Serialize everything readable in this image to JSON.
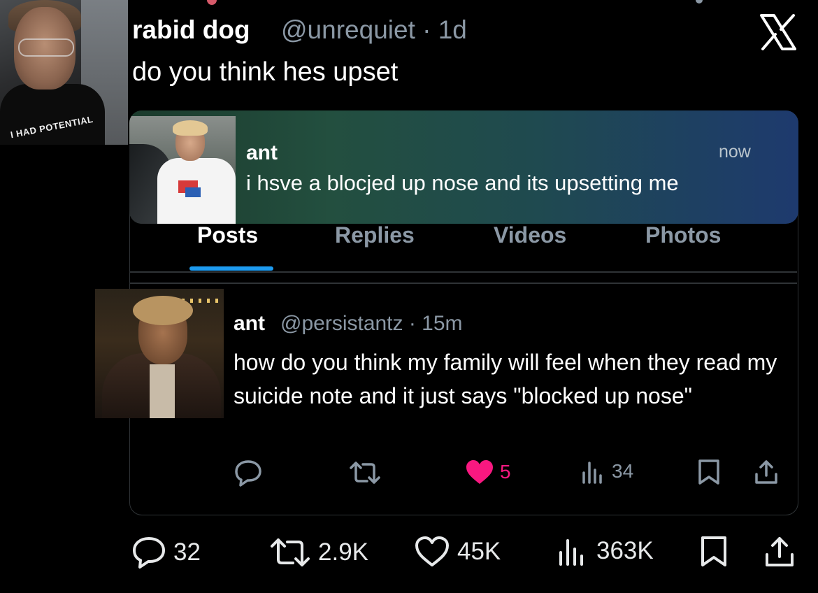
{
  "header": {
    "name": "rabid dog",
    "handle_time": "@unrequiet · 1d",
    "text": "do you think hes upset",
    "avatar_shirt_text": "I HAD POTENTIAL"
  },
  "notification": {
    "name": "ant",
    "time": "now",
    "text": "i hsve a blocjed up nose and its upsetting me"
  },
  "tabs": [
    "Posts",
    "Replies",
    "Videos",
    "Photos"
  ],
  "tweet": {
    "name": "ant",
    "handle_time": "@persistantz · 15m",
    "text": "how do you think my family will feel when they read my suicide note and it just says \"blocked up nose\"",
    "actions": {
      "likes": "5",
      "views": "34"
    }
  },
  "stats": {
    "replies": "32",
    "reposts": "2.9K",
    "likes": "45K",
    "views": "363K"
  },
  "colors": {
    "accent": "#1d9bf0",
    "like_pink": "#f91880",
    "muted": "#8b98a5"
  }
}
